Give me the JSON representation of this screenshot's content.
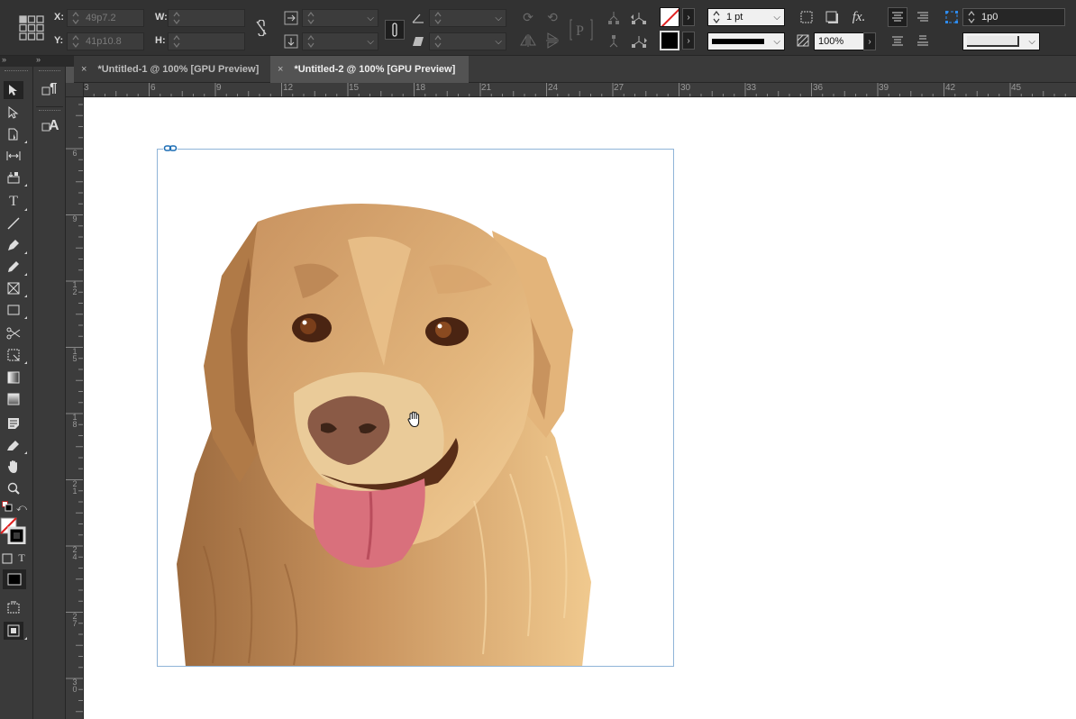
{
  "control_bar": {
    "x_label": "X:",
    "x_value": "49p7.2",
    "y_label": "Y:",
    "y_value": "41p10.8",
    "w_label": "W:",
    "h_label": "H:",
    "stroke_weight": "1 pt",
    "opacity": "100%",
    "gap_value": "1p0"
  },
  "tabs": [
    {
      "label": "*Untitled-1 @ 100% [GPU Preview]",
      "active": false
    },
    {
      "label": "*Untitled-2 @ 100% [GPU Preview]",
      "active": true
    }
  ],
  "ruler_top": [
    "3",
    "6",
    "9",
    "12",
    "15",
    "18",
    "21",
    "24",
    "27",
    "30",
    "33",
    "36",
    "39",
    "42",
    "45"
  ],
  "ruler_left": [
    "6",
    "9",
    "1\n2",
    "1\n5",
    "1\n8",
    "2\n1",
    "2\n4",
    "2\n7",
    "3\n0"
  ],
  "colors": {
    "frame_border": "#8fb4d8",
    "dog_base": "#d9a86c"
  },
  "icons": {
    "close_tab": "×",
    "panel_collapse": "»"
  }
}
